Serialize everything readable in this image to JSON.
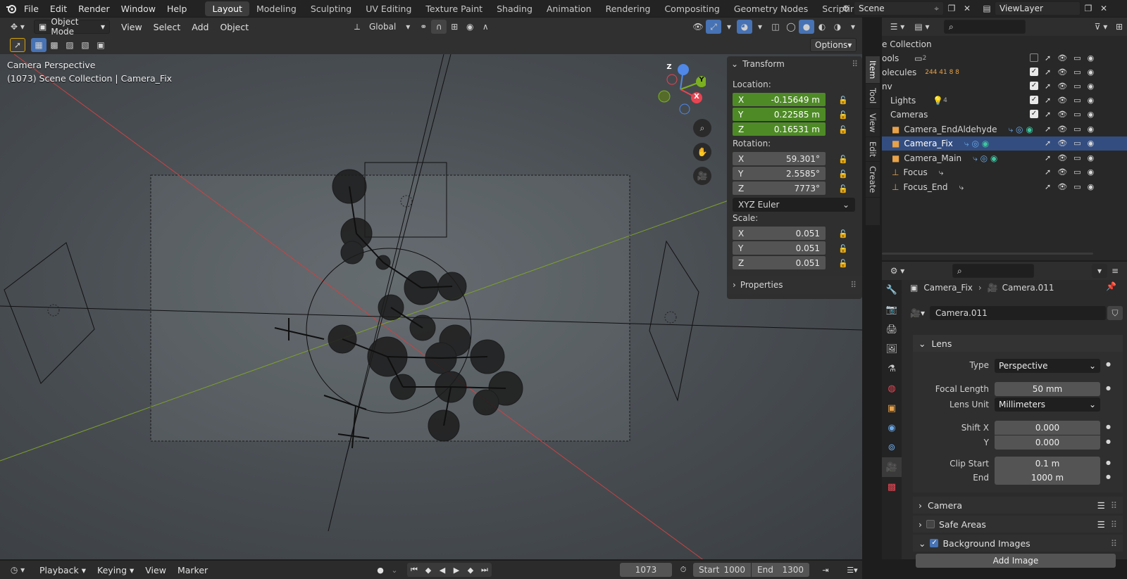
{
  "menu": [
    "File",
    "Edit",
    "Render",
    "Window",
    "Help"
  ],
  "workspaces": [
    "Layout",
    "Modeling",
    "Sculpting",
    "UV Editing",
    "Texture Paint",
    "Shading",
    "Animation",
    "Rendering",
    "Compositing",
    "Geometry Nodes",
    "Scripting"
  ],
  "active_workspace": "Layout",
  "scene_name": "Scene",
  "view_layer": "ViewLayer",
  "viewport_header": {
    "mode": "Object Mode",
    "menus": [
      "View",
      "Select",
      "Add",
      "Object"
    ],
    "orientation": "Global",
    "options_label": "Options"
  },
  "overlay": {
    "view_name": "Camera Perspective",
    "info": "(1073) Scene Collection | Camera_Fix"
  },
  "gizmo": {
    "z": "Z",
    "y": "Y",
    "x": "X"
  },
  "npanel": {
    "transform_title": "Transform",
    "location_label": "Location:",
    "location": [
      {
        "axis": "X",
        "value": "-0.15649 m"
      },
      {
        "axis": "Y",
        "value": "0.22585 m"
      },
      {
        "axis": "Z",
        "value": "0.16531 m"
      }
    ],
    "rotation_label": "Rotation:",
    "rotation": [
      {
        "axis": "X",
        "value": "59.301°"
      },
      {
        "axis": "Y",
        "value": "2.5585°"
      },
      {
        "axis": "Z",
        "value": "7773°"
      }
    ],
    "rotation_mode": "XYZ Euler",
    "scale_label": "Scale:",
    "scale": [
      {
        "axis": "X",
        "value": "0.051"
      },
      {
        "axis": "Y",
        "value": "0.051"
      },
      {
        "axis": "Z",
        "value": "0.051"
      }
    ],
    "properties_title": "Properties"
  },
  "side_tabs": [
    "Item",
    "Tool",
    "View",
    "Edit",
    "Create"
  ],
  "outliner": {
    "root": "e Collection",
    "rows": [
      {
        "label": "ools",
        "badge": "2"
      },
      {
        "label": "olecules",
        "badge": "244  41  8  8"
      },
      {
        "label": "nv",
        "badge": ""
      },
      {
        "label": "Lights",
        "badge": "4"
      },
      {
        "label": "Cameras",
        "badge": ""
      },
      {
        "label": "Camera_EndAldehyde",
        "badge": ""
      },
      {
        "label": "Camera_Fix",
        "badge": ""
      },
      {
        "label": "Camera_Main",
        "badge": ""
      },
      {
        "label": "Focus",
        "badge": ""
      },
      {
        "label": "Focus_End",
        "badge": ""
      }
    ]
  },
  "properties": {
    "object_name": "Camera_Fix",
    "data_name": "Camera.011",
    "datablock": "Camera.011",
    "lens_section": "Lens",
    "type_label": "Type",
    "type_value": "Perspective",
    "focal_label": "Focal Length",
    "focal_value": "50 mm",
    "lens_unit_label": "Lens Unit",
    "lens_unit_value": "Millimeters",
    "shift_x_label": "Shift X",
    "shift_x_value": "0.000",
    "shift_y_label": "Y",
    "shift_y_value": "0.000",
    "clip_start_label": "Clip Start",
    "clip_start_value": "0.1 m",
    "clip_end_label": "End",
    "clip_end_value": "1000 m",
    "camera_section": "Camera",
    "safe_areas_section": "Safe Areas",
    "bg_images_section": "Background Images",
    "add_image_label": "Add Image"
  },
  "timeline": {
    "menus": [
      "Playback",
      "Keying",
      "View",
      "Marker"
    ],
    "current_frame": "1073",
    "start_label": "Start",
    "start_value": "1000",
    "end_label": "End",
    "end_value": "1300"
  }
}
